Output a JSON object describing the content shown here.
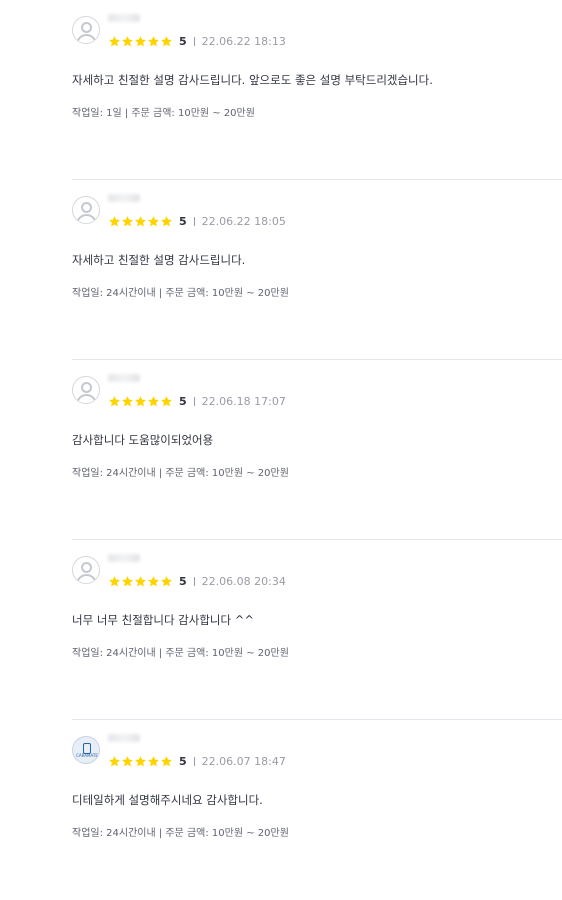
{
  "colors": {
    "star": "#FFD400",
    "divider": "#e4e5ed",
    "text": "#303441",
    "muted": "#9a9ba7"
  },
  "icons": {
    "avatar": "user-avatar-icon",
    "star": "star-icon"
  },
  "reviews": [
    {
      "rating": "5",
      "date": "22.06.22 18:13",
      "content": "자세하고 친절한 설명 감사드립니다. 앞으로도 좋은 설명 부탁드리겠습니다.",
      "info": "작업일: 1일 | 주문 금액: 10만원 ~ 20만원"
    },
    {
      "rating": "5",
      "date": "22.06.22 18:05",
      "content": "자세하고 친절한 설명 감사드립니다.",
      "info": "작업일: 24시간이내 | 주문 금액: 10만원 ~ 20만원"
    },
    {
      "rating": "5",
      "date": "22.06.18 17:07",
      "content": "감사합니다 도움많이되었어용",
      "info": "작업일: 24시간이내 | 주문 금액: 10만원 ~ 20만원"
    },
    {
      "rating": "5",
      "date": "22.06.08 20:34",
      "content": "너무 너무 친절합니다 감사합니다 ^^",
      "info": "작업일: 24시간이내 | 주문 금액: 10만원 ~ 20만원"
    },
    {
      "rating": "5",
      "date": "22.06.07 18:47",
      "content": "디테일하게 설명해주시네요 감사합니다.",
      "info": "작업일: 24시간이내 | 주문 금액: 10만원 ~ 20만원",
      "avatar_label": "CARAMATE"
    }
  ]
}
